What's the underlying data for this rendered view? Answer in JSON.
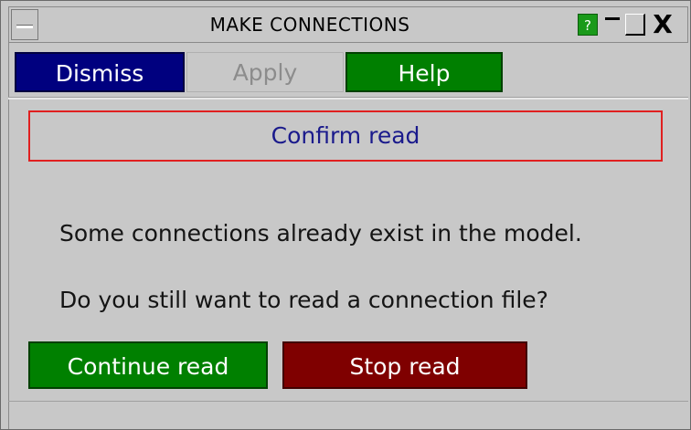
{
  "window": {
    "title": "MAKE CONNECTIONS",
    "help_glyph": "?",
    "close_glyph": "X"
  },
  "toolbar": {
    "dismiss_label": "Dismiss",
    "apply_label": "Apply",
    "help_label": "Help"
  },
  "panel": {
    "heading": "Confirm read",
    "message_1": "Some connections already exist in the model.",
    "message_2": "Do you still want to read a connection file?"
  },
  "actions": {
    "continue_label": "Continue read",
    "stop_label": "Stop read"
  },
  "colors": {
    "background": "#c8c8c8",
    "dismiss": "#00007f",
    "help": "#007f00",
    "continue": "#008000",
    "stop": "#7f0000",
    "heading_border": "#e02020",
    "heading_text": "#1a1a8c"
  }
}
